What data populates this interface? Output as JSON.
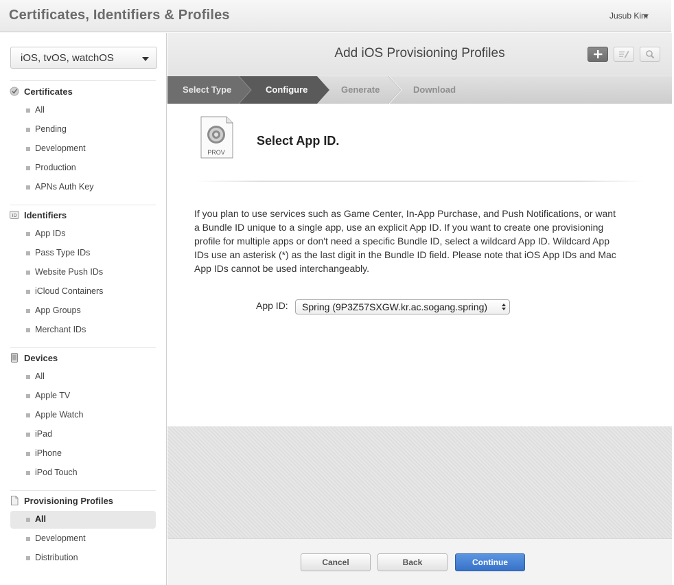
{
  "header": {
    "app_title": "Certificates, Identifiers & Profiles",
    "user": "Jusub Kim"
  },
  "sidebar": {
    "platform": "iOS, tvOS, watchOS",
    "sections": [
      {
        "title": "Certificates",
        "icon": "certificate-icon",
        "items": [
          "All",
          "Pending",
          "Development",
          "Production",
          "APNs Auth Key"
        ]
      },
      {
        "title": "Identifiers",
        "icon": "id-badge-icon",
        "items": [
          "App IDs",
          "Pass Type IDs",
          "Website Push IDs",
          "iCloud Containers",
          "App Groups",
          "Merchant IDs"
        ]
      },
      {
        "title": "Devices",
        "icon": "device-icon",
        "items": [
          "All",
          "Apple TV",
          "Apple Watch",
          "iPad",
          "iPhone",
          "iPod Touch"
        ]
      },
      {
        "title": "Provisioning Profiles",
        "icon": "document-icon",
        "items": [
          "All",
          "Development",
          "Distribution"
        ],
        "active_item": "All"
      }
    ]
  },
  "main": {
    "title": "Add iOS Provisioning Profiles",
    "toolbar_icons": [
      "add-icon",
      "edit-icon",
      "search-icon"
    ],
    "steps": [
      "Select Type",
      "Configure",
      "Generate",
      "Download"
    ],
    "current_step": "Configure",
    "file_badge": "PROV",
    "heading": "Select App ID.",
    "description": "If you plan to use services such as Game Center, In-App Purchase, and Push Notifications, or want a Bundle ID unique to a single app, use an explicit App ID. If you want to create one provisioning profile for multiple apps or don't need a specific Bundle ID, select a wildcard App ID. Wildcard App IDs use an asterisk (*) as the last digit in the Bundle ID field. Please note that iOS App IDs and Mac App IDs cannot be used interchangeably.",
    "app_id_label": "App ID:",
    "app_id_value": "Spring (9P3Z57SXGW.kr.ac.sogang.spring)"
  },
  "buttons": {
    "cancel": "Cancel",
    "back": "Back",
    "continue": "Continue"
  },
  "colors": {
    "primary_button": "#3772c9",
    "step_done": "#6e6e6e",
    "step_current": "#5b5b5b"
  }
}
